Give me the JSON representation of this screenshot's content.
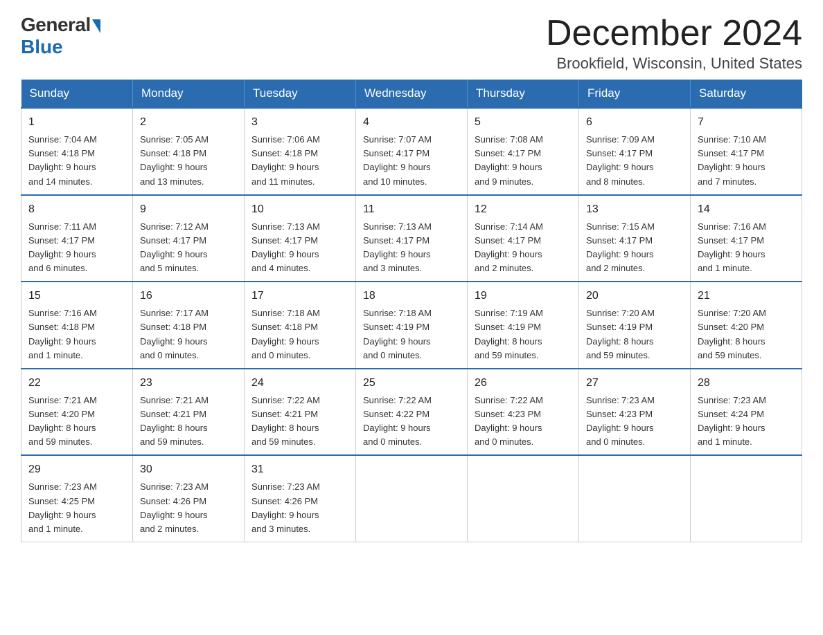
{
  "header": {
    "logo_general": "General",
    "logo_blue": "Blue",
    "month_title": "December 2024",
    "location": "Brookfield, Wisconsin, United States"
  },
  "days_of_week": [
    "Sunday",
    "Monday",
    "Tuesday",
    "Wednesday",
    "Thursday",
    "Friday",
    "Saturday"
  ],
  "weeks": [
    [
      {
        "day": "1",
        "sunrise": "7:04 AM",
        "sunset": "4:18 PM",
        "daylight": "9 hours and 14 minutes."
      },
      {
        "day": "2",
        "sunrise": "7:05 AM",
        "sunset": "4:18 PM",
        "daylight": "9 hours and 13 minutes."
      },
      {
        "day": "3",
        "sunrise": "7:06 AM",
        "sunset": "4:18 PM",
        "daylight": "9 hours and 11 minutes."
      },
      {
        "day": "4",
        "sunrise": "7:07 AM",
        "sunset": "4:17 PM",
        "daylight": "9 hours and 10 minutes."
      },
      {
        "day": "5",
        "sunrise": "7:08 AM",
        "sunset": "4:17 PM",
        "daylight": "9 hours and 9 minutes."
      },
      {
        "day": "6",
        "sunrise": "7:09 AM",
        "sunset": "4:17 PM",
        "daylight": "9 hours and 8 minutes."
      },
      {
        "day": "7",
        "sunrise": "7:10 AM",
        "sunset": "4:17 PM",
        "daylight": "9 hours and 7 minutes."
      }
    ],
    [
      {
        "day": "8",
        "sunrise": "7:11 AM",
        "sunset": "4:17 PM",
        "daylight": "9 hours and 6 minutes."
      },
      {
        "day": "9",
        "sunrise": "7:12 AM",
        "sunset": "4:17 PM",
        "daylight": "9 hours and 5 minutes."
      },
      {
        "day": "10",
        "sunrise": "7:13 AM",
        "sunset": "4:17 PM",
        "daylight": "9 hours and 4 minutes."
      },
      {
        "day": "11",
        "sunrise": "7:13 AM",
        "sunset": "4:17 PM",
        "daylight": "9 hours and 3 minutes."
      },
      {
        "day": "12",
        "sunrise": "7:14 AM",
        "sunset": "4:17 PM",
        "daylight": "9 hours and 2 minutes."
      },
      {
        "day": "13",
        "sunrise": "7:15 AM",
        "sunset": "4:17 PM",
        "daylight": "9 hours and 2 minutes."
      },
      {
        "day": "14",
        "sunrise": "7:16 AM",
        "sunset": "4:17 PM",
        "daylight": "9 hours and 1 minute."
      }
    ],
    [
      {
        "day": "15",
        "sunrise": "7:16 AM",
        "sunset": "4:18 PM",
        "daylight": "9 hours and 1 minute."
      },
      {
        "day": "16",
        "sunrise": "7:17 AM",
        "sunset": "4:18 PM",
        "daylight": "9 hours and 0 minutes."
      },
      {
        "day": "17",
        "sunrise": "7:18 AM",
        "sunset": "4:18 PM",
        "daylight": "9 hours and 0 minutes."
      },
      {
        "day": "18",
        "sunrise": "7:18 AM",
        "sunset": "4:19 PM",
        "daylight": "9 hours and 0 minutes."
      },
      {
        "day": "19",
        "sunrise": "7:19 AM",
        "sunset": "4:19 PM",
        "daylight": "8 hours and 59 minutes."
      },
      {
        "day": "20",
        "sunrise": "7:20 AM",
        "sunset": "4:19 PM",
        "daylight": "8 hours and 59 minutes."
      },
      {
        "day": "21",
        "sunrise": "7:20 AM",
        "sunset": "4:20 PM",
        "daylight": "8 hours and 59 minutes."
      }
    ],
    [
      {
        "day": "22",
        "sunrise": "7:21 AM",
        "sunset": "4:20 PM",
        "daylight": "8 hours and 59 minutes."
      },
      {
        "day": "23",
        "sunrise": "7:21 AM",
        "sunset": "4:21 PM",
        "daylight": "8 hours and 59 minutes."
      },
      {
        "day": "24",
        "sunrise": "7:22 AM",
        "sunset": "4:21 PM",
        "daylight": "8 hours and 59 minutes."
      },
      {
        "day": "25",
        "sunrise": "7:22 AM",
        "sunset": "4:22 PM",
        "daylight": "9 hours and 0 minutes."
      },
      {
        "day": "26",
        "sunrise": "7:22 AM",
        "sunset": "4:23 PM",
        "daylight": "9 hours and 0 minutes."
      },
      {
        "day": "27",
        "sunrise": "7:23 AM",
        "sunset": "4:23 PM",
        "daylight": "9 hours and 0 minutes."
      },
      {
        "day": "28",
        "sunrise": "7:23 AM",
        "sunset": "4:24 PM",
        "daylight": "9 hours and 1 minute."
      }
    ],
    [
      {
        "day": "29",
        "sunrise": "7:23 AM",
        "sunset": "4:25 PM",
        "daylight": "9 hours and 1 minute."
      },
      {
        "day": "30",
        "sunrise": "7:23 AM",
        "sunset": "4:26 PM",
        "daylight": "9 hours and 2 minutes."
      },
      {
        "day": "31",
        "sunrise": "7:23 AM",
        "sunset": "4:26 PM",
        "daylight": "9 hours and 3 minutes."
      },
      null,
      null,
      null,
      null
    ]
  ],
  "labels": {
    "sunrise": "Sunrise:",
    "sunset": "Sunset:",
    "daylight": "Daylight:"
  }
}
